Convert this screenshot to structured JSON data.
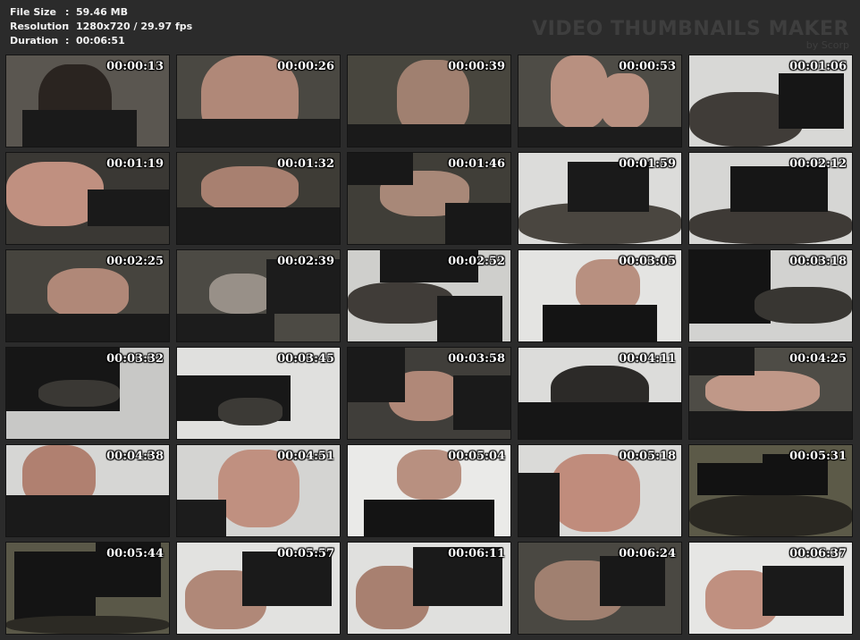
{
  "meta": {
    "file_size_label": "File Size",
    "file_size_value": "59.46 MB",
    "resolution_label": "Resolution",
    "resolution_value": "1280x720 / 29.97 fps",
    "duration_label": "Duration",
    "duration_value": "00:06:51",
    "separator": ":"
  },
  "brand": {
    "title": "VIDEO THUMBNAILS MAKER",
    "subtitle": "by Scorp"
  },
  "thumbnails": [
    {
      "time": "00:00:13",
      "bg": "#5a5650",
      "fg": "#2a2420",
      "accent": "#1a1a1a"
    },
    {
      "time": "00:00:26",
      "bg": "#4a4842",
      "fg": "#b08878",
      "accent": "#1c1c1c"
    },
    {
      "time": "00:00:39",
      "bg": "#48463e",
      "fg": "#a08070",
      "accent": "#1a1a1a"
    },
    {
      "time": "00:00:53",
      "bg": "#4e4c46",
      "fg": "#b89080",
      "accent": "#1c1c1c"
    },
    {
      "time": "00:01:06",
      "bg": "#d8d8d6",
      "fg": "#403c38",
      "accent": "#161616"
    },
    {
      "time": "00:01:19",
      "bg": "#3a3834",
      "fg": "#c09080",
      "accent": "#1a1a1a"
    },
    {
      "time": "00:01:32",
      "bg": "#3e3c36",
      "fg": "#a88070",
      "accent": "#1a1a1a"
    },
    {
      "time": "00:01:46",
      "bg": "#403e38",
      "fg": "#a88878",
      "accent": "#181818"
    },
    {
      "time": "00:01:59",
      "bg": "#dcdcda",
      "fg": "#4a4640",
      "accent": "#1a1a1a"
    },
    {
      "time": "00:02:12",
      "bg": "#d6d6d4",
      "fg": "#3e3a36",
      "accent": "#161616"
    },
    {
      "time": "00:02:25",
      "bg": "#46443e",
      "fg": "#b08878",
      "accent": "#1a1a1a"
    },
    {
      "time": "00:02:39",
      "bg": "#4c4a44",
      "fg": "#989088",
      "accent": "#1c1c1c"
    },
    {
      "time": "00:02:52",
      "bg": "#cfcfcc",
      "fg": "#403c38",
      "accent": "#181818"
    },
    {
      "time": "00:03:05",
      "bg": "#e4e4e2",
      "fg": "#b89080",
      "accent": "#141414"
    },
    {
      "time": "00:03:18",
      "bg": "#d2d2d0",
      "fg": "#383632",
      "accent": "#141414"
    },
    {
      "time": "00:03:32",
      "bg": "#c8c8c6",
      "fg": "#3a3834",
      "accent": "#161616"
    },
    {
      "time": "00:03:45",
      "bg": "#e0e0de",
      "fg": "#3c3a36",
      "accent": "#181818"
    },
    {
      "time": "00:03:58",
      "bg": "#403e3a",
      "fg": "#b08878",
      "accent": "#1a1a1a"
    },
    {
      "time": "00:04:11",
      "bg": "#dcdcda",
      "fg": "#2c2a28",
      "accent": "#161616"
    },
    {
      "time": "00:04:25",
      "bg": "#4e4c46",
      "fg": "#c09888",
      "accent": "#1a1a1a"
    },
    {
      "time": "00:04:38",
      "bg": "#d6d6d4",
      "fg": "#b08070",
      "accent": "#1a1a1a"
    },
    {
      "time": "00:04:51",
      "bg": "#d4d4d2",
      "fg": "#c09080",
      "accent": "#1c1c1c"
    },
    {
      "time": "00:05:04",
      "bg": "#eaeae8",
      "fg": "#b89080",
      "accent": "#141414"
    },
    {
      "time": "00:05:18",
      "bg": "#dadad8",
      "fg": "#c08c7c",
      "accent": "#1a1a1a"
    },
    {
      "time": "00:05:31",
      "bg": "#5c5a48",
      "fg": "#2a2822",
      "accent": "#121212"
    },
    {
      "time": "00:05:44",
      "bg": "#5a5848",
      "fg": "#2c2a24",
      "accent": "#141414"
    },
    {
      "time": "00:05:57",
      "bg": "#e2e2e0",
      "fg": "#b08878",
      "accent": "#1a1a1a"
    },
    {
      "time": "00:06:11",
      "bg": "#e0e0de",
      "fg": "#a88070",
      "accent": "#1a1a1a"
    },
    {
      "time": "00:06:24",
      "bg": "#4a4842",
      "fg": "#a08070",
      "accent": "#181818"
    },
    {
      "time": "00:06:37",
      "bg": "#e6e6e4",
      "fg": "#c09080",
      "accent": "#1a1a1a"
    }
  ]
}
